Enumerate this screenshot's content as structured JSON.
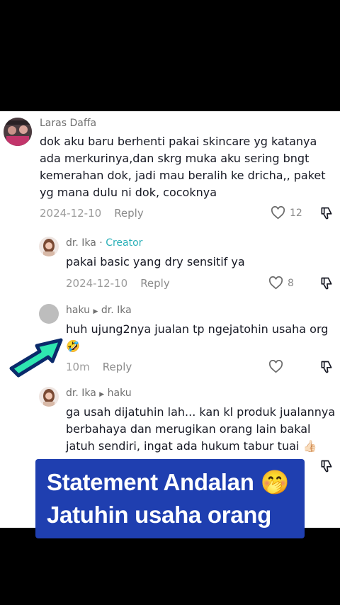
{
  "comments": [
    {
      "user": "Laras Daffa",
      "text": "dok aku baru berhenti pakai skincare yg katanya ada merkurinya,dan skrg muka aku sering bngt kemerahan dok, jadi mau beralih ke dricha,, paket yg mana dulu ni dok, cocoknya",
      "date": "2024-12-10",
      "reply": "Reply",
      "likes": "12"
    },
    {
      "user": "dr. Ika",
      "sep": "·",
      "badge": "Creator",
      "text": "pakai basic yang dry sensitif ya",
      "date": "2024-12-10",
      "reply": "Reply",
      "likes": "8"
    },
    {
      "user": "haku",
      "reply_to": "dr. Ika",
      "text": "huh ujung2nya jualan tp ngejatohin usaha org",
      "emoji": "🤣",
      "date": "10m",
      "reply": "Reply"
    },
    {
      "user": "dr. Ika",
      "reply_to": "haku",
      "text": "ga usah dijatuhin lah... kan kl produk jualannya berbahaya dan merugikan orang lain bakal jatuh sendiri, ingat ada hukum tabur tuai",
      "emoji": "👍🏻"
    }
  ],
  "banner": {
    "line1": "Statement Andalan",
    "emoji": "🤭",
    "line2": "Jatuhin usaha orang"
  },
  "icons": [
    "heart-icon",
    "dislike-icon",
    "pointer-arrow-icon",
    "avatar"
  ],
  "colors": {
    "creator": "#2ab0b8",
    "banner": "#1f3fb0",
    "arrow": "#2ee6b0"
  }
}
